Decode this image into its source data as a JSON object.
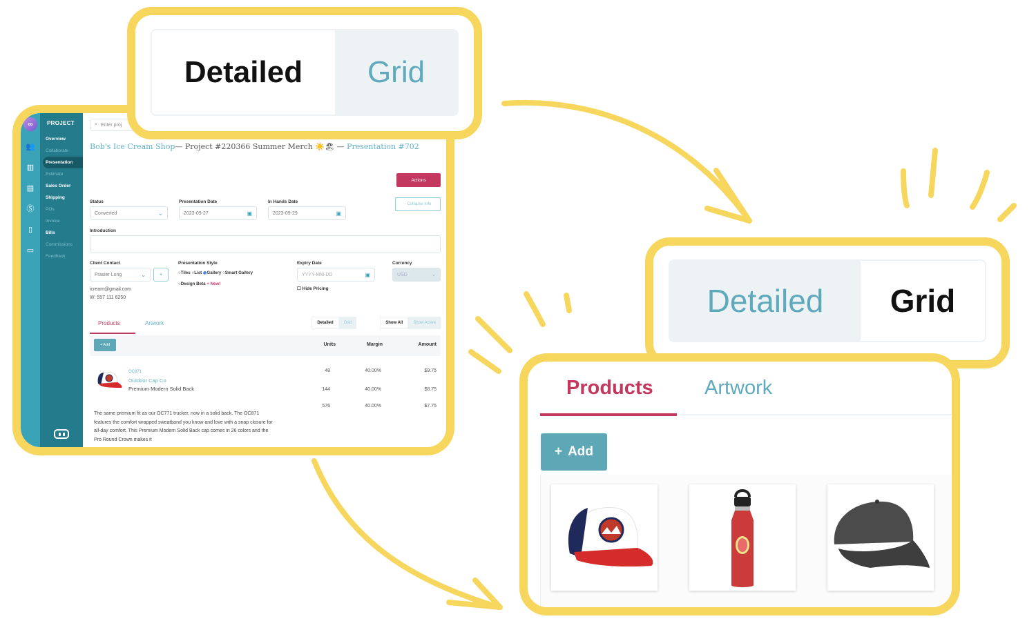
{
  "app": {
    "sidebar": {
      "section_title": "PROJECT",
      "logo_icon": "infinity-logo-icon",
      "rail_icons": [
        "users-icon",
        "chart-icon",
        "calendar-card-icon",
        "dollar-circle-icon",
        "building-icon",
        "book-icon"
      ],
      "items": [
        {
          "label": "Overview",
          "state": "enabled"
        },
        {
          "label": "Collaborate",
          "state": "disabled"
        },
        {
          "label": "Presentation",
          "state": "active"
        },
        {
          "label": "Estimate",
          "state": "disabled"
        },
        {
          "label": "Sales Order",
          "state": "enabled"
        },
        {
          "label": "Shipping",
          "state": "enabled"
        },
        {
          "label": "POs",
          "state": "disabled"
        },
        {
          "label": "Invoice",
          "state": "disabled"
        },
        {
          "label": "Bills",
          "state": "enabled"
        },
        {
          "label": "Commissions",
          "state": "disabled"
        },
        {
          "label": "Feedback",
          "state": "disabled"
        }
      ],
      "bot_icon": "robot-icon"
    },
    "search": {
      "placeholder": "Enter proj"
    },
    "header": {
      "client_link": "Bob's Ice Cream Shop",
      "project_text": "— Project #220366 Summer Merch ☀️🏖 — ",
      "presentation_link": "Presentation #702"
    },
    "actions_label": "Actions",
    "collapse_label": "- Collapse Info",
    "fields": {
      "status": {
        "label": "Status",
        "value": "Converted"
      },
      "presentation_date": {
        "label": "Presentation Date",
        "value": "2023-09-27"
      },
      "in_hands_date": {
        "label": "In Hands Date",
        "value": "2023-09-29"
      },
      "introduction": {
        "label": "Introduction",
        "value": ""
      },
      "client_contact": {
        "label": "Client Contact",
        "value": "Frasier Long",
        "add_label": "+"
      },
      "contact_email": "icream@gmail.com",
      "contact_phone": "W: 557 111 6250",
      "presentation_style": {
        "label": "Presentation Style",
        "options": [
          "Tiles",
          "List",
          "Gallery",
          "Smart Gallery",
          "Design Beta"
        ],
        "selected": "Gallery",
        "new_badge": "+ New!"
      },
      "expiry_date": {
        "label": "Expiry Date",
        "placeholder": "YYYY-MM-DD"
      },
      "hide_pricing": {
        "label": "Hide Pricing",
        "checked": false
      },
      "currency": {
        "label": "Currency",
        "value": "USD"
      }
    },
    "tabs": {
      "products": "Products",
      "artwork": "Artwork"
    },
    "view_toggle": {
      "detailed": "Detailed",
      "grid": "Grid",
      "active": "Detailed"
    },
    "filter_toggle": {
      "show_all": "Show All",
      "show_active": "Show Active",
      "active": "Show All"
    },
    "add_label": "+ Add",
    "columns": {
      "units": "Units",
      "margin": "Margin",
      "amount": "Amount"
    },
    "product": {
      "code": "OC871",
      "supplier": "Outdoor Cap Co",
      "name": "Premium Modern Solid Back",
      "description": "The same premium fit as our OC771 trucker, now in a solid back. The OC871 features the comfort wrapped sweatband you know and love with a snap closure for all-day comfort. This Premium Modern Solid Back cap comes in 26 colors and the Pro Round Crown makes it",
      "price_rows": [
        {
          "units": "48",
          "margin": "40.00%",
          "amount": "$9.75"
        },
        {
          "units": "144",
          "margin": "40.00%",
          "amount": "$8.75"
        },
        {
          "units": "576",
          "margin": "40.00%",
          "amount": "$7.75"
        }
      ]
    }
  },
  "callout_detailed": {
    "detailed": "Detailed",
    "grid": "Grid",
    "active": "Detailed"
  },
  "callout_grid": {
    "detailed": "Detailed",
    "grid": "Grid",
    "active": "Grid"
  },
  "grid_view": {
    "tabs": {
      "products": "Products",
      "artwork": "Artwork",
      "active": "Products"
    },
    "add_label": "Add",
    "add_icon": "plus-icon",
    "products": [
      {
        "image": "trucker-cap-red-white-navy"
      },
      {
        "image": "red-water-bottle"
      },
      {
        "image": "grey-baseball-cap"
      }
    ]
  },
  "colors": {
    "highlight": "#f7d65e",
    "accent_teal": "#3aa3b8",
    "accent_red": "#c2385e",
    "nav_dark": "#237b8c"
  }
}
